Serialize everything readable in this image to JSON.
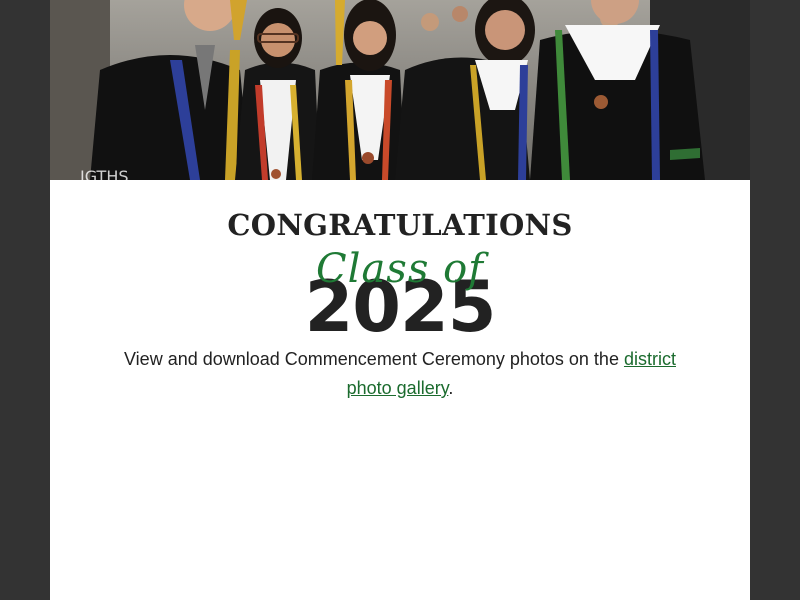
{
  "hero": {
    "image_alt": "Graduates in black gowns with white stoles and colorful cords smiling at commencement"
  },
  "content": {
    "heading": "CONGRATULATIONS",
    "script_text": "Class of",
    "year": "2025",
    "description_prefix": "View and download Commencement Ceremony photos on the ",
    "link_text": "district photo gallery",
    "description_suffix": "."
  },
  "colors": {
    "background": "#333333",
    "card": "#ffffff",
    "accent_green": "#1f7a35",
    "link_green": "#1b6b2e",
    "text_dark": "#222222"
  }
}
